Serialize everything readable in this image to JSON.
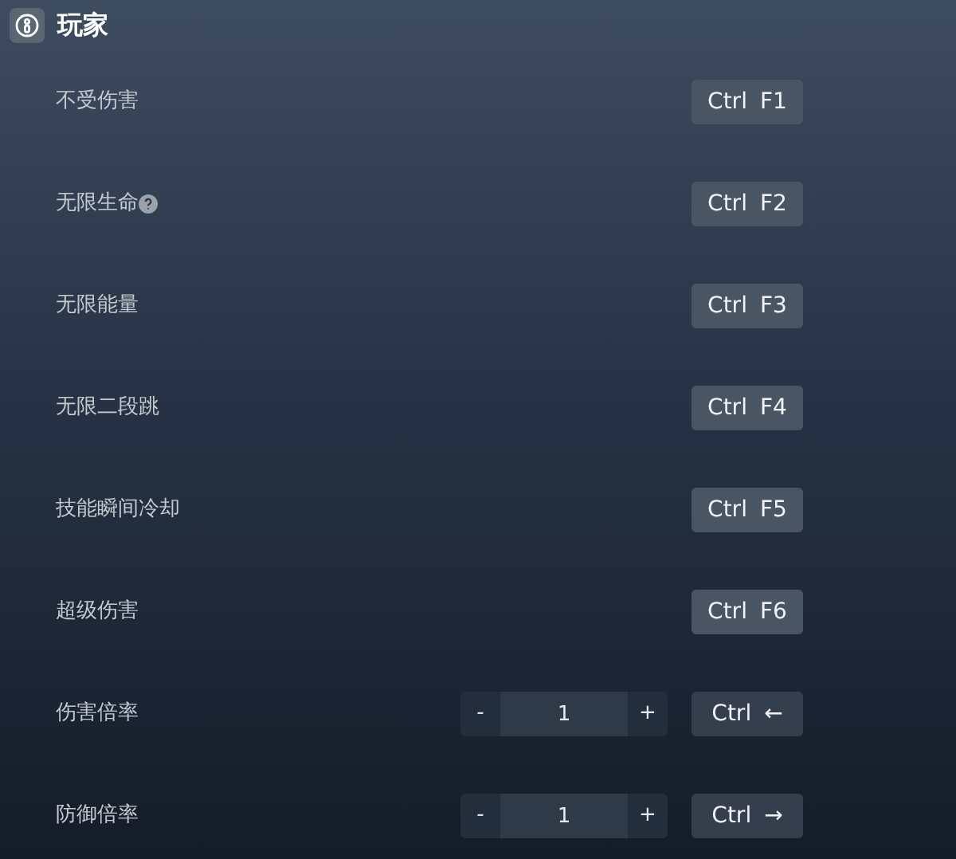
{
  "section": {
    "title": "玩家"
  },
  "rows": [
    {
      "kind": "toggle",
      "label": "不受伤害",
      "help": false,
      "keys": [
        "Ctrl",
        "F1"
      ]
    },
    {
      "kind": "toggle",
      "label": "无限生命",
      "help": true,
      "keys": [
        "Ctrl",
        "F2"
      ]
    },
    {
      "kind": "toggle",
      "label": "无限能量",
      "help": false,
      "keys": [
        "Ctrl",
        "F3"
      ]
    },
    {
      "kind": "toggle",
      "label": "无限二段跳",
      "help": false,
      "keys": [
        "Ctrl",
        "F4"
      ]
    },
    {
      "kind": "toggle",
      "label": "技能瞬间冷却",
      "help": false,
      "keys": [
        "Ctrl",
        "F5"
      ]
    },
    {
      "kind": "toggle",
      "label": "超级伤害",
      "help": false,
      "keys": [
        "Ctrl",
        "F6"
      ]
    },
    {
      "kind": "stepper",
      "label": "伤害倍率",
      "help": false,
      "minus": "-",
      "value": "1",
      "plus": "+",
      "keys": [
        "Ctrl",
        "←"
      ]
    },
    {
      "kind": "stepper",
      "label": "防御倍率",
      "help": false,
      "minus": "-",
      "value": "1",
      "plus": "+",
      "keys": [
        "Ctrl",
        "→"
      ]
    }
  ]
}
